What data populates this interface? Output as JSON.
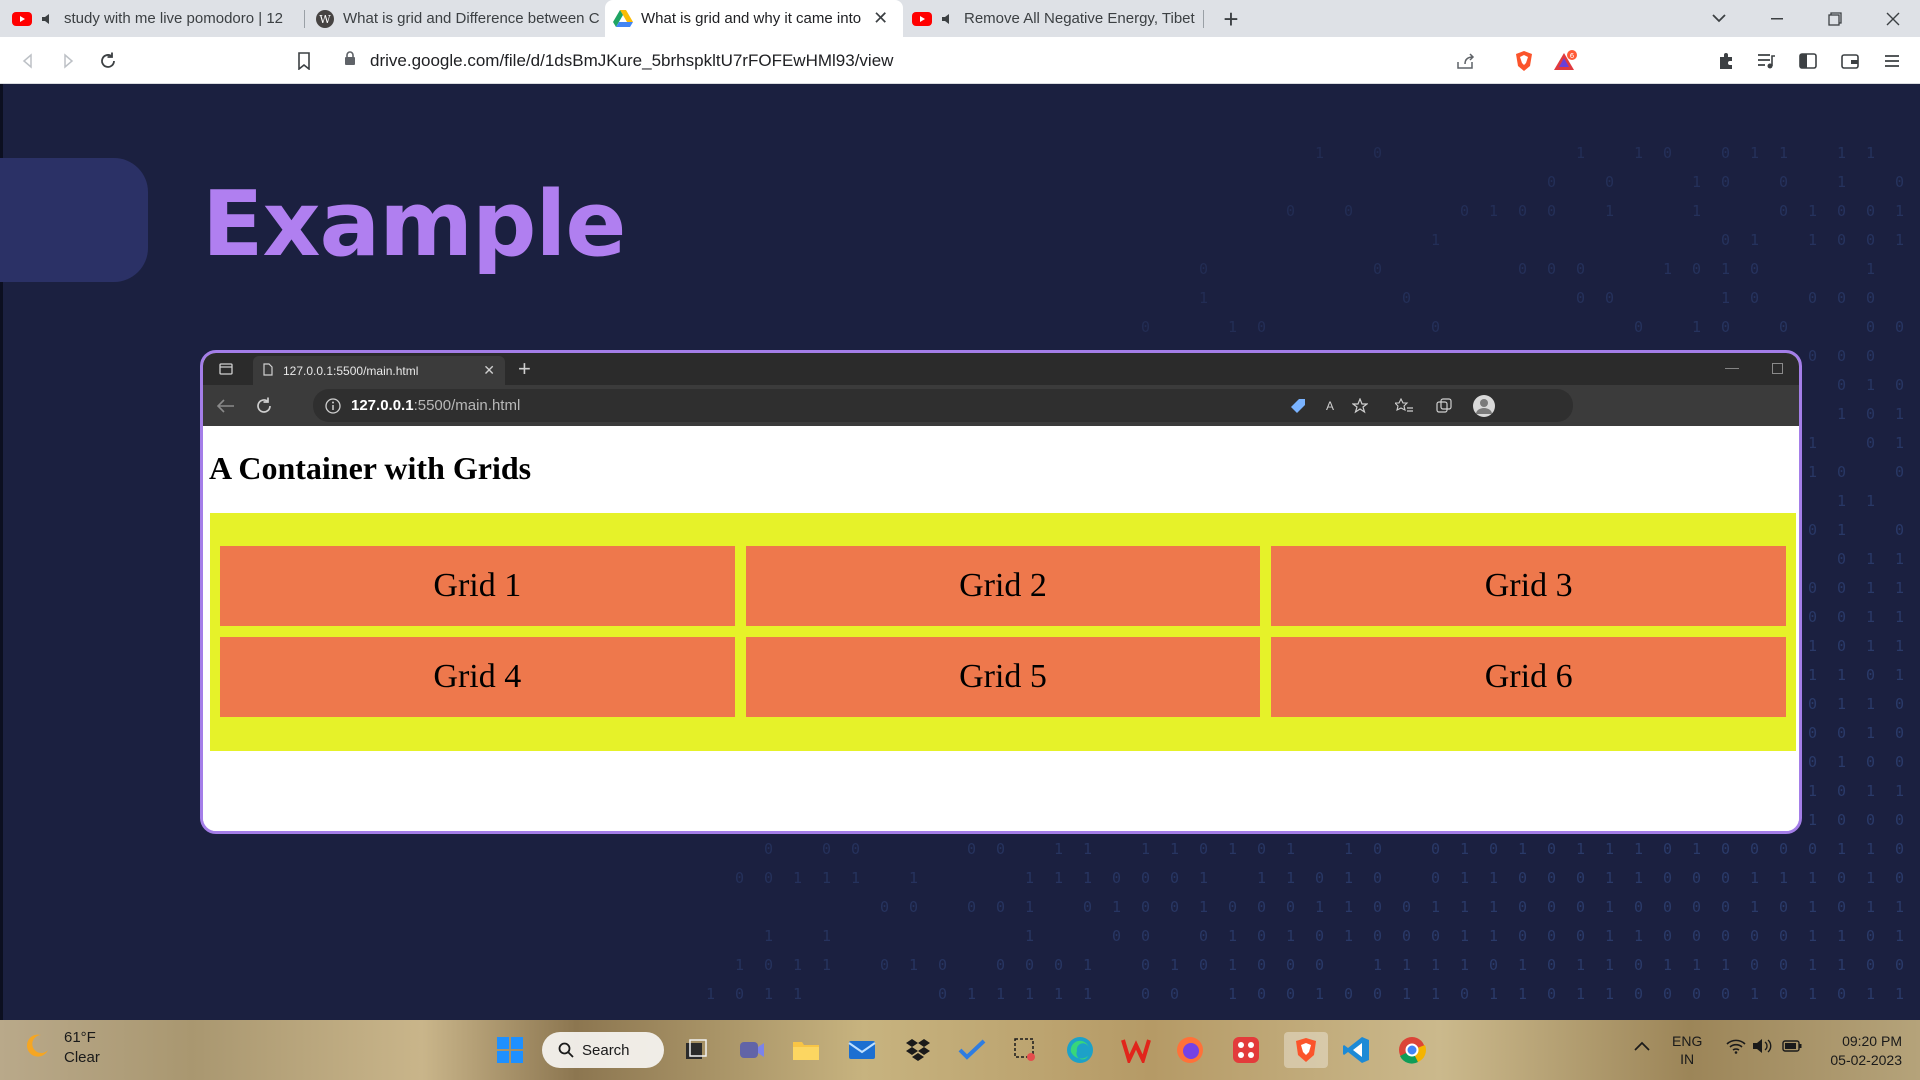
{
  "browser": {
    "tabs": [
      {
        "title": "study with me live pomodoro | 12",
        "favicon": "youtube-icon",
        "audio": true,
        "active": false
      },
      {
        "title": "What is grid and Difference between C",
        "favicon": "wordpress-icon",
        "audio": false,
        "active": false
      },
      {
        "title": "What is grid and why it came into",
        "favicon": "google-drive-icon",
        "audio": false,
        "active": true
      },
      {
        "title": "Remove All Negative Energy, Tibet",
        "favicon": "youtube-icon",
        "audio": true,
        "active": false
      }
    ],
    "new_tab_label": "+",
    "url": "drive.google.com/file/d/1dsBmJKure_5brhspkltU7rFOFEwHMl93/view",
    "accent_color": "#ffffff"
  },
  "slide": {
    "title": "Example",
    "title_color": "#b07ff0",
    "background_color": "#1b2040"
  },
  "inner_browser": {
    "tab_title": "127.0.0.1:5500/main.html",
    "url_host": "127.0.0.1",
    "url_path": ":5500/main.html",
    "border_color": "#a47ee8"
  },
  "webpage": {
    "heading": "A Container with Grids",
    "container_color": "#e6f229",
    "item_color": "#ee784c",
    "grid_items": [
      "Grid 1",
      "Grid 2",
      "Grid 3",
      "Grid 4",
      "Grid 5",
      "Grid 6"
    ]
  },
  "taskbar": {
    "weather_temp": "61°F",
    "weather_condition": "Clear",
    "search_label": "Search",
    "language": "ENG",
    "region": "IN",
    "time": "09:20 PM",
    "date": "05-02-2023"
  }
}
